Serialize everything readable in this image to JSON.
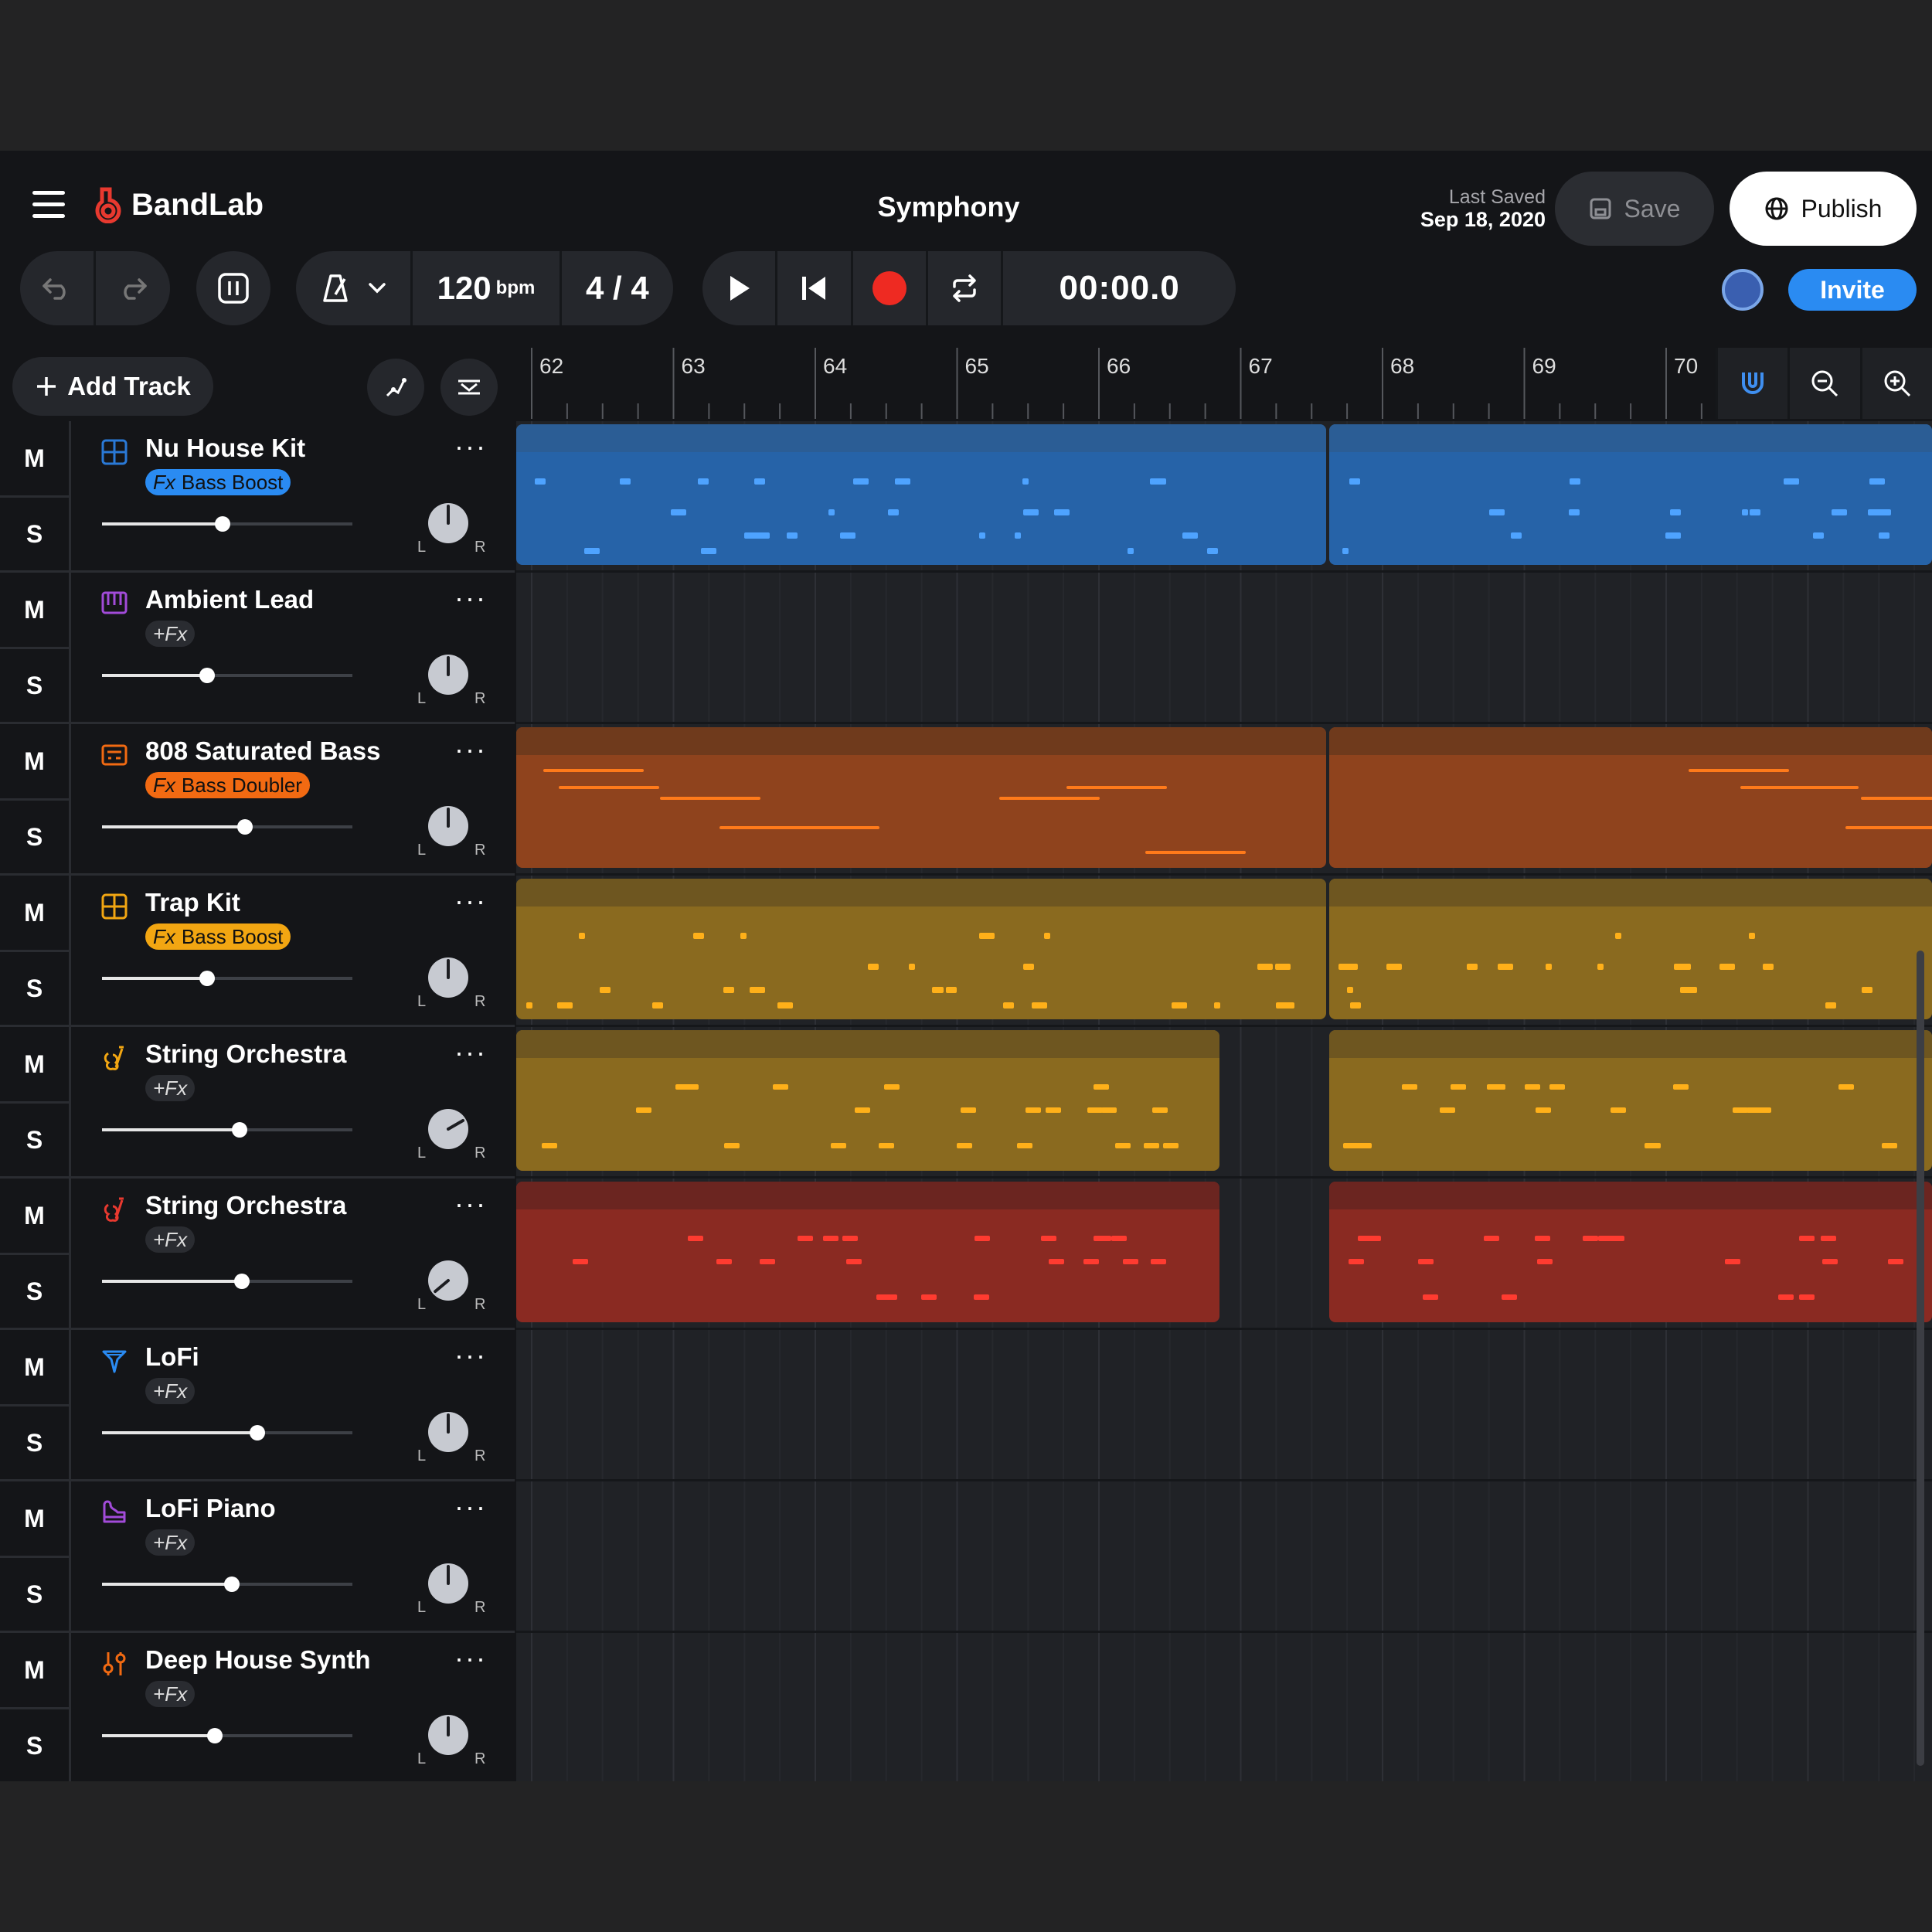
{
  "app": {
    "logo_text": "BandLab",
    "project_title": "Symphony",
    "last_saved_label": "Last Saved",
    "last_saved_date": "Sep 18, 2020",
    "save_label": "Save",
    "publish_label": "Publish",
    "invite_label": "Invite"
  },
  "transport": {
    "tempo": "120",
    "tempo_unit": "bpm",
    "time_signature": "4 / 4",
    "timecode": "00:00.0"
  },
  "left_panel": {
    "add_track_label": "Add Track"
  },
  "ruler": {
    "bars": [
      "62",
      "63",
      "64",
      "65",
      "66",
      "67",
      "68",
      "69",
      "70"
    ]
  },
  "mute_label": "M",
  "solo_label": "S",
  "pan_left": "L",
  "pan_right": "R",
  "more_label": "···",
  "tracks": [
    {
      "name": "Nu House Kit",
      "fx": "Bass Boost",
      "fx_prefix": "Fx",
      "color": "#2a79d6",
      "icon": "drum-grid-icon",
      "volume": 0.48
    },
    {
      "name": "Ambient Lead",
      "fx": "+Fx",
      "color": "#a24bd9",
      "icon": "keyboard-icon",
      "volume": 0.42
    },
    {
      "name": "808 Saturated Bass",
      "fx": "Bass Doubler",
      "fx_prefix": "Fx",
      "color": "#f26a12",
      "icon": "synth-box-icon",
      "volume": 0.57
    },
    {
      "name": "Trap Kit",
      "fx": "Bass Boost",
      "fx_prefix": "Fx",
      "color": "#f2a612",
      "icon": "drum-grid-icon",
      "volume": 0.42
    },
    {
      "name": "String Orchestra",
      "fx": "+Fx",
      "color": "#f2a612",
      "icon": "violin-icon",
      "volume": 0.55
    },
    {
      "name": "String Orchestra",
      "fx": "+Fx",
      "color": "#e8392f",
      "icon": "violin-icon",
      "volume": 0.56
    },
    {
      "name": "LoFi",
      "fx": "+Fx",
      "color": "#2a8bf2",
      "icon": "lofi-icon",
      "volume": 0.62
    },
    {
      "name": "LoFi Piano",
      "fx": "+Fx",
      "color": "#a24bd9",
      "icon": "piano-icon",
      "volume": 0.52
    },
    {
      "name": "Deep House Synth",
      "fx": "+Fx",
      "color": "#f26a12",
      "icon": "synth-sliders-icon",
      "volume": 0.45
    }
  ]
}
